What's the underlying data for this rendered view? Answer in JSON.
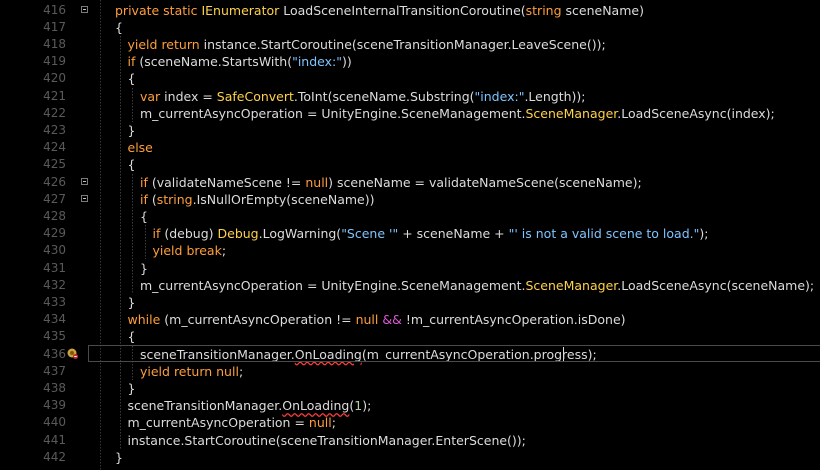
{
  "editor": {
    "lines": [
      {
        "num": "416",
        "tokens": [
          [
            "kw",
            "private static "
          ],
          [
            "ty",
            "IEnumerator"
          ],
          [
            "pl",
            " LoadSceneInternalTransitionCoroutine("
          ],
          [
            "kw",
            "string"
          ],
          [
            "pl",
            " sceneName)"
          ]
        ]
      },
      {
        "num": "417",
        "tokens": [
          [
            "pl",
            "{"
          ]
        ]
      },
      {
        "num": "418",
        "tokens": [
          [
            "kw",
            "yield return"
          ],
          [
            "pl",
            " instance.StartCoroutine(sceneTransitionManager.LeaveScene());"
          ]
        ]
      },
      {
        "num": "419",
        "tokens": [
          [
            "kw",
            "if"
          ],
          [
            "pl",
            " (sceneName.StartsWith("
          ],
          [
            "st",
            "\"index:\""
          ],
          [
            "pl",
            "))"
          ]
        ]
      },
      {
        "num": "420",
        "tokens": [
          [
            "pl",
            "{"
          ]
        ]
      },
      {
        "num": "421",
        "tokens": [
          [
            "kw",
            "var"
          ],
          [
            "pl",
            " index = "
          ],
          [
            "ty",
            "SafeConvert"
          ],
          [
            "pl",
            ".ToInt(sceneName.Substring("
          ],
          [
            "st",
            "\"index:\""
          ],
          [
            "pl",
            ".Length));"
          ]
        ]
      },
      {
        "num": "422",
        "tokens": [
          [
            "pl",
            "m_currentAsyncOperation = UnityEngine.SceneManagement."
          ],
          [
            "ty",
            "SceneManager"
          ],
          [
            "pl",
            ".LoadSceneAsync(index);"
          ]
        ]
      },
      {
        "num": "423",
        "tokens": [
          [
            "pl",
            "}"
          ]
        ]
      },
      {
        "num": "424",
        "tokens": [
          [
            "kw",
            "else"
          ]
        ]
      },
      {
        "num": "425",
        "tokens": [
          [
            "pl",
            "{"
          ]
        ]
      },
      {
        "num": "426",
        "tokens": [
          [
            "kw",
            "if"
          ],
          [
            "pl",
            " (validateNameScene != "
          ],
          [
            "kw",
            "null"
          ],
          [
            "pl",
            ") sceneName = validateNameScene(sceneName);"
          ]
        ]
      },
      {
        "num": "427",
        "tokens": [
          [
            "kw",
            "if"
          ],
          [
            "pl",
            " ("
          ],
          [
            "kw",
            "string"
          ],
          [
            "pl",
            ".IsNullOrEmpty(sceneName))"
          ]
        ]
      },
      {
        "num": "428",
        "tokens": [
          [
            "pl",
            "{"
          ]
        ]
      },
      {
        "num": "429",
        "tokens": [
          [
            "kw",
            "if"
          ],
          [
            "pl",
            " (debug) "
          ],
          [
            "ty",
            "Debug"
          ],
          [
            "pl",
            ".LogWarning("
          ],
          [
            "st",
            "\"Scene '\""
          ],
          [
            "pl",
            " + sceneName + "
          ],
          [
            "st",
            "\"' is not a valid scene to load.\""
          ],
          [
            "pl",
            ");"
          ]
        ]
      },
      {
        "num": "430",
        "tokens": [
          [
            "kw",
            "yield break"
          ],
          [
            "pl",
            ";"
          ]
        ]
      },
      {
        "num": "431",
        "tokens": [
          [
            "pl",
            "}"
          ]
        ]
      },
      {
        "num": "432",
        "tokens": [
          [
            "pl",
            "m_currentAsyncOperation = UnityEngine.SceneManagement."
          ],
          [
            "ty",
            "SceneManager"
          ],
          [
            "pl",
            ".LoadSceneAsync(sceneName);"
          ]
        ]
      },
      {
        "num": "433",
        "tokens": [
          [
            "pl",
            "}"
          ]
        ]
      },
      {
        "num": "434",
        "tokens": [
          [
            "kw",
            "while"
          ],
          [
            "pl",
            " (m_currentAsyncOperation != "
          ],
          [
            "kw",
            "null"
          ],
          [
            "pl",
            " "
          ],
          [
            "op",
            "&&"
          ],
          [
            "pl",
            " !m_currentAsyncOperation.isDone)"
          ]
        ]
      },
      {
        "num": "435",
        "tokens": [
          [
            "pl",
            "{"
          ]
        ]
      },
      {
        "num": "436",
        "tokens": [
          [
            "pl",
            "sceneTransitionManager."
          ],
          [
            "sq",
            "OnLoading"
          ],
          [
            "pl",
            "(m_currentAsyncOperation.progress);"
          ]
        ]
      },
      {
        "num": "437",
        "tokens": [
          [
            "kw",
            "yield return null"
          ],
          [
            "pl",
            ";"
          ]
        ]
      },
      {
        "num": "438",
        "tokens": [
          [
            "pl",
            "}"
          ]
        ]
      },
      {
        "num": "439",
        "tokens": [
          [
            "pl",
            "sceneTransitionManager."
          ],
          [
            "sq",
            "OnLoading"
          ],
          [
            "pl",
            "("
          ],
          [
            "nm",
            "1"
          ],
          [
            "pl",
            ");"
          ]
        ]
      },
      {
        "num": "440",
        "tokens": [
          [
            "pl",
            "m_currentAsyncOperation = "
          ],
          [
            "kw",
            "null"
          ],
          [
            "pl",
            ";"
          ]
        ]
      },
      {
        "num": "441",
        "tokens": [
          [
            "pl",
            "instance.StartCoroutine(sceneTransitionManager.EnterScene());"
          ]
        ]
      },
      {
        "num": "442",
        "tokens": [
          [
            "pl",
            "}"
          ]
        ]
      }
    ]
  },
  "colors": {
    "keyword": "#ff9e3b",
    "type": "#ffd24a",
    "string": "#7fc4ff",
    "number": "#b5cea8",
    "operator": "#e05ad8",
    "plain": "#dcdcdc",
    "line_number": "#5a5a5a",
    "background": "#000000"
  },
  "icons": {
    "breakpoint": "breakpoint-warning-icon",
    "fold": "collapse-icon"
  }
}
